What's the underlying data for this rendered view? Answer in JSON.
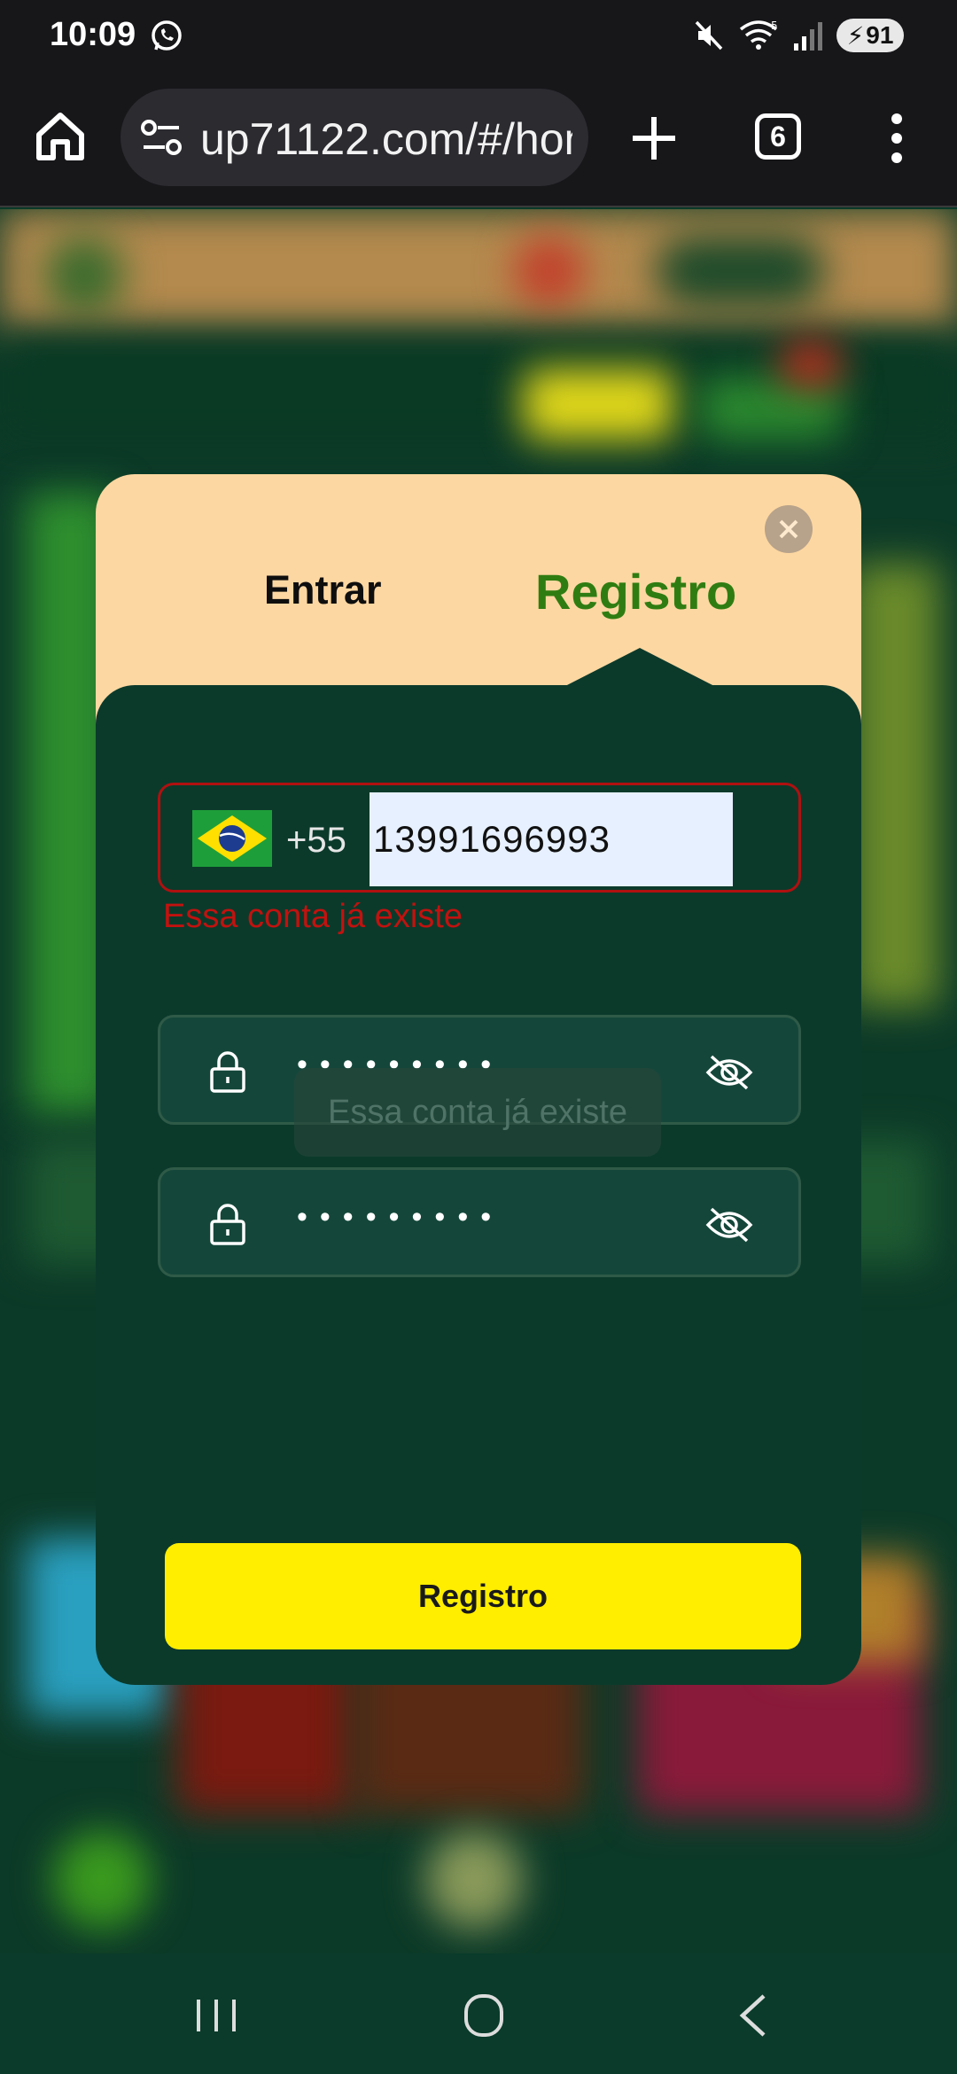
{
  "status_bar": {
    "time": "10:09",
    "battery": "91",
    "icons": [
      "whatsapp-icon",
      "mute-icon",
      "wifi-icon",
      "signal-icon",
      "battery-icon"
    ]
  },
  "browser": {
    "url": "up71122.com/#/hom",
    "tab_count": "6",
    "icons": [
      "home-icon",
      "site-settings-icon",
      "plus-icon",
      "tabs-icon",
      "more-vert-icon"
    ]
  },
  "modal": {
    "tabs": {
      "login": "Entrar",
      "register": "Registro"
    },
    "active_tab": "register",
    "phone": {
      "country_flag": "brazil-flag-icon",
      "dial_code": "+55",
      "value": "13991696993"
    },
    "error": "Essa conta já existe",
    "password": "•••••••••",
    "confirm_password": "•••••••••",
    "toast": "Essa conta já existe",
    "submit_label": "Registro"
  },
  "colors": {
    "modal_header": "#fdd7a1",
    "modal_body": "#0b3a2b",
    "active_tab": "#2f7d12",
    "error": "#c2120f",
    "submit": "#ffee00"
  }
}
